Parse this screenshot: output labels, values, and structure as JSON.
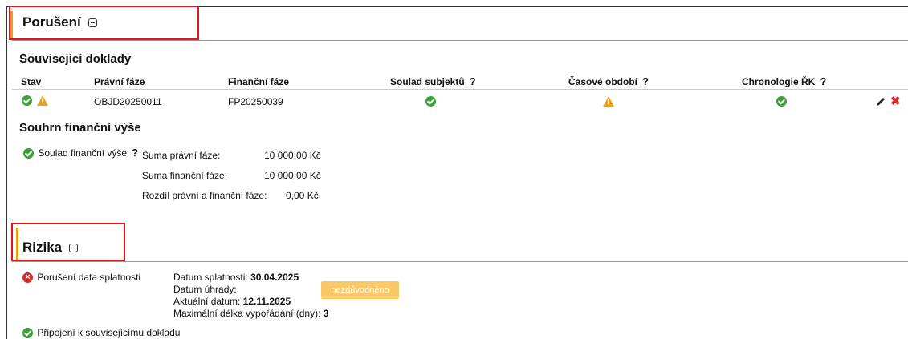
{
  "violations": {
    "title": "Porušení",
    "related_docs": {
      "title": "Související doklady",
      "columns": [
        "Stav",
        "Právní fáze",
        "Finanční fáze",
        "Soulad subjektů",
        "Časové období",
        "Chronologie ŘK"
      ],
      "rows": [
        {
          "legal_phase": "OBJD20250011",
          "financial_phase": "FP20250039"
        }
      ]
    },
    "financial_summary": {
      "title": "Souhrn finanční výše",
      "status_label": "Soulad finanční výše",
      "items": [
        {
          "label": "Suma právní fáze:",
          "value": "10 000,00 Kč"
        },
        {
          "label": "Suma finanční fáze:",
          "value": "10 000,00 Kč"
        },
        {
          "label": "Rozdíl právní a finanční fáze:",
          "value": "0,00 Kč"
        }
      ]
    }
  },
  "risks": {
    "title": "Rizika",
    "items": [
      {
        "label": "Porušení data splatnosti",
        "due_label": "Datum splatnosti:",
        "due_value": "30.04.2025",
        "paid_label": "Datum úhrady:",
        "current_label": "Aktuální datum:",
        "current_value": "12.11.2025",
        "max_label": "Maximální délka vypořádání (dny):",
        "max_value": "3",
        "button": "nezdůvodněno"
      },
      {
        "label": "Připojení k souvisejícímu dokladu"
      }
    ]
  },
  "colors": {
    "ok": "#3aa335",
    "warning": "#e8a21a",
    "error": "#d0312d",
    "highlight": "#e0131e",
    "button": "#fbc868",
    "section_bar": "#e8a21a"
  },
  "icons": [
    "ok-icon",
    "warning-icon",
    "error-icon",
    "collapse-icon",
    "pencil-icon",
    "delete-icon",
    "help-icon"
  ]
}
